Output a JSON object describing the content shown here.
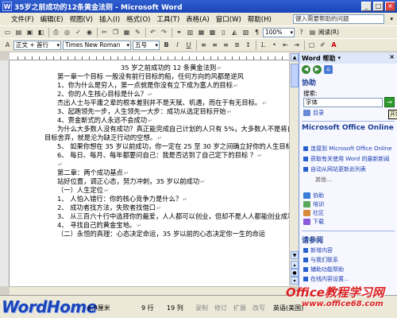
{
  "window": {
    "title": "35岁之前成功的12条黄金法则 - Microsoft Word",
    "buttons": [
      "_",
      "□",
      "×"
    ]
  },
  "menubar": {
    "items": [
      "文件(F)",
      "编辑(E)",
      "视图(V)",
      "插入(I)",
      "格式(O)",
      "工具(T)",
      "表格(A)",
      "窗口(W)",
      "帮助(H)"
    ],
    "ask_placeholder": "键入需要帮助的问题"
  },
  "toolbar": {
    "zoom": "100%",
    "read_label": "阅读(R)",
    "style": "正文 + 首行",
    "font": "Times New Roman",
    "size": "五号"
  },
  "document": {
    "lines": [
      "35 岁之前成功的 12 条黄金法则",
      "第一章一个目标   一般没有前行目标的船，任何方向的风都是逆风",
      "1、你为什么是穷人，第一点就是你没有立下成为富人的目标",
      "2、你的人生核心目标是什么？",
      "杰出人士与平庸之辈的根本差别并不是天赋、机遇，而在于有无目标。",
      "3、起跑领先一步，人生领先一大步：成功从选定目标开始",
      "4、贾金斯式的人永远不会成功",
      "为什么大多数人没有成功？真正能完成自己计划的人只有 5%，大多数人不是将自己的",
      "目标舍弃，就是沦为缺乏行动的空想。",
      "5、 如果你想在 35 岁以前成功，你一定在 25 至 30 岁之间确立好你的人生目标",
      "6、 每日、每月、每年都要问自己：我是否达到了自己定下的目标 ？",
      "",
      "第二章：两个成功基点",
      "站好位置，调正心态，努力冲刺，35 岁以前成功",
      "（一）人生定位",
      "1、 人怕入错行：你的核心竞争力是什么？",
      "2、 成功者找方法，失败者找借口",
      "3、 从三百六十行中选择你的最爱，人人都可以创业，但却不是人人都能创业成功",
      "4、 寻找自己的黄金宝地。",
      "（二）永恒的真理：心态决定命运，35 岁以前的心态决定你一生的命运"
    ]
  },
  "taskpane": {
    "title": "Word 帮助",
    "assist_heading": "协助",
    "search_label": "搜索:",
    "search_value": "字体",
    "go_tooltip": "开始",
    "toc_link": "目录",
    "online_heading": "Microsoft Office Online",
    "online_links": [
      "连接到 Microsoft Office Online",
      "获取有关使用 Word 的最新新闻",
      "自动从网站更新此列表"
    ],
    "more": "其他...",
    "help_links": [
      "协助",
      "培训",
      "社区",
      "下载"
    ],
    "see_also_heading": "请参阅",
    "see_also_links": [
      "新增内容",
      "与我们联系",
      "辅助功能帮助",
      "在线内容设置..."
    ]
  },
  "statusbar": {
    "brand": "WordHome",
    "position": "6.9厘米",
    "line": "9 行",
    "col": "19 列",
    "rec": "录制",
    "trk": "修订",
    "ext": "扩展",
    "ovr": "改写",
    "lang": "英语(美国)"
  },
  "watermark": {
    "brand": "Office教程学习网",
    "url": "www.office68.com"
  }
}
